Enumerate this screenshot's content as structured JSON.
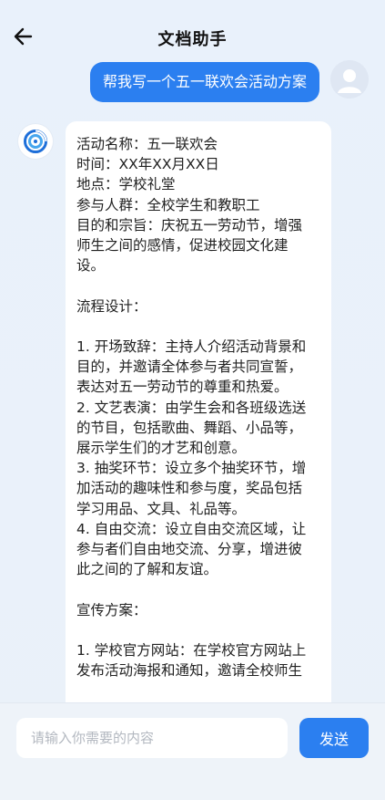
{
  "header": {
    "title": "文档助手",
    "back_icon": "arrow-left-icon"
  },
  "user_message": {
    "text": "帮我写一个五一联欢会活动方案"
  },
  "assistant_message": {
    "lines": [
      "活动名称：五一联欢会",
      "时间：XX年XX月XX日",
      "地点：学校礼堂",
      "参与人群：全校学生和教职工",
      "目的和宗旨：庆祝五一劳动节，增强",
      "师生之间的感情，促进校园文化建",
      "设。",
      "",
      "流程设计：",
      "",
      "1. 开场致辞：主持人介绍活动背景和",
      "目的，并邀请全体参与者共同宣誓，",
      "表达对五一劳动节的尊重和热爱。",
      "2. 文艺表演：由学生会和各班级选送",
      "的节目，包括歌曲、舞蹈、小品等，",
      "展示学生们的才艺和创意。",
      "3. 抽奖环节：设立多个抽奖环节，增",
      "加活动的趣味性和参与度，奖品包括",
      "学习用品、文具、礼品等。",
      "4. 自由交流：设立自由交流区域，让",
      "参与者们自由地交流、分享，增进彼",
      "此之间的了解和友谊。",
      "",
      "宣传方案：",
      "",
      "1. 学校官方网站：在学校官方网站上",
      "发布活动海报和通知，邀请全校师生"
    ]
  },
  "input": {
    "placeholder": "请输入你需要的内容",
    "value": ""
  },
  "send_button": {
    "label": "发送"
  },
  "colors": {
    "accent": "#2b7ff0",
    "background": "#e9f1fb"
  }
}
